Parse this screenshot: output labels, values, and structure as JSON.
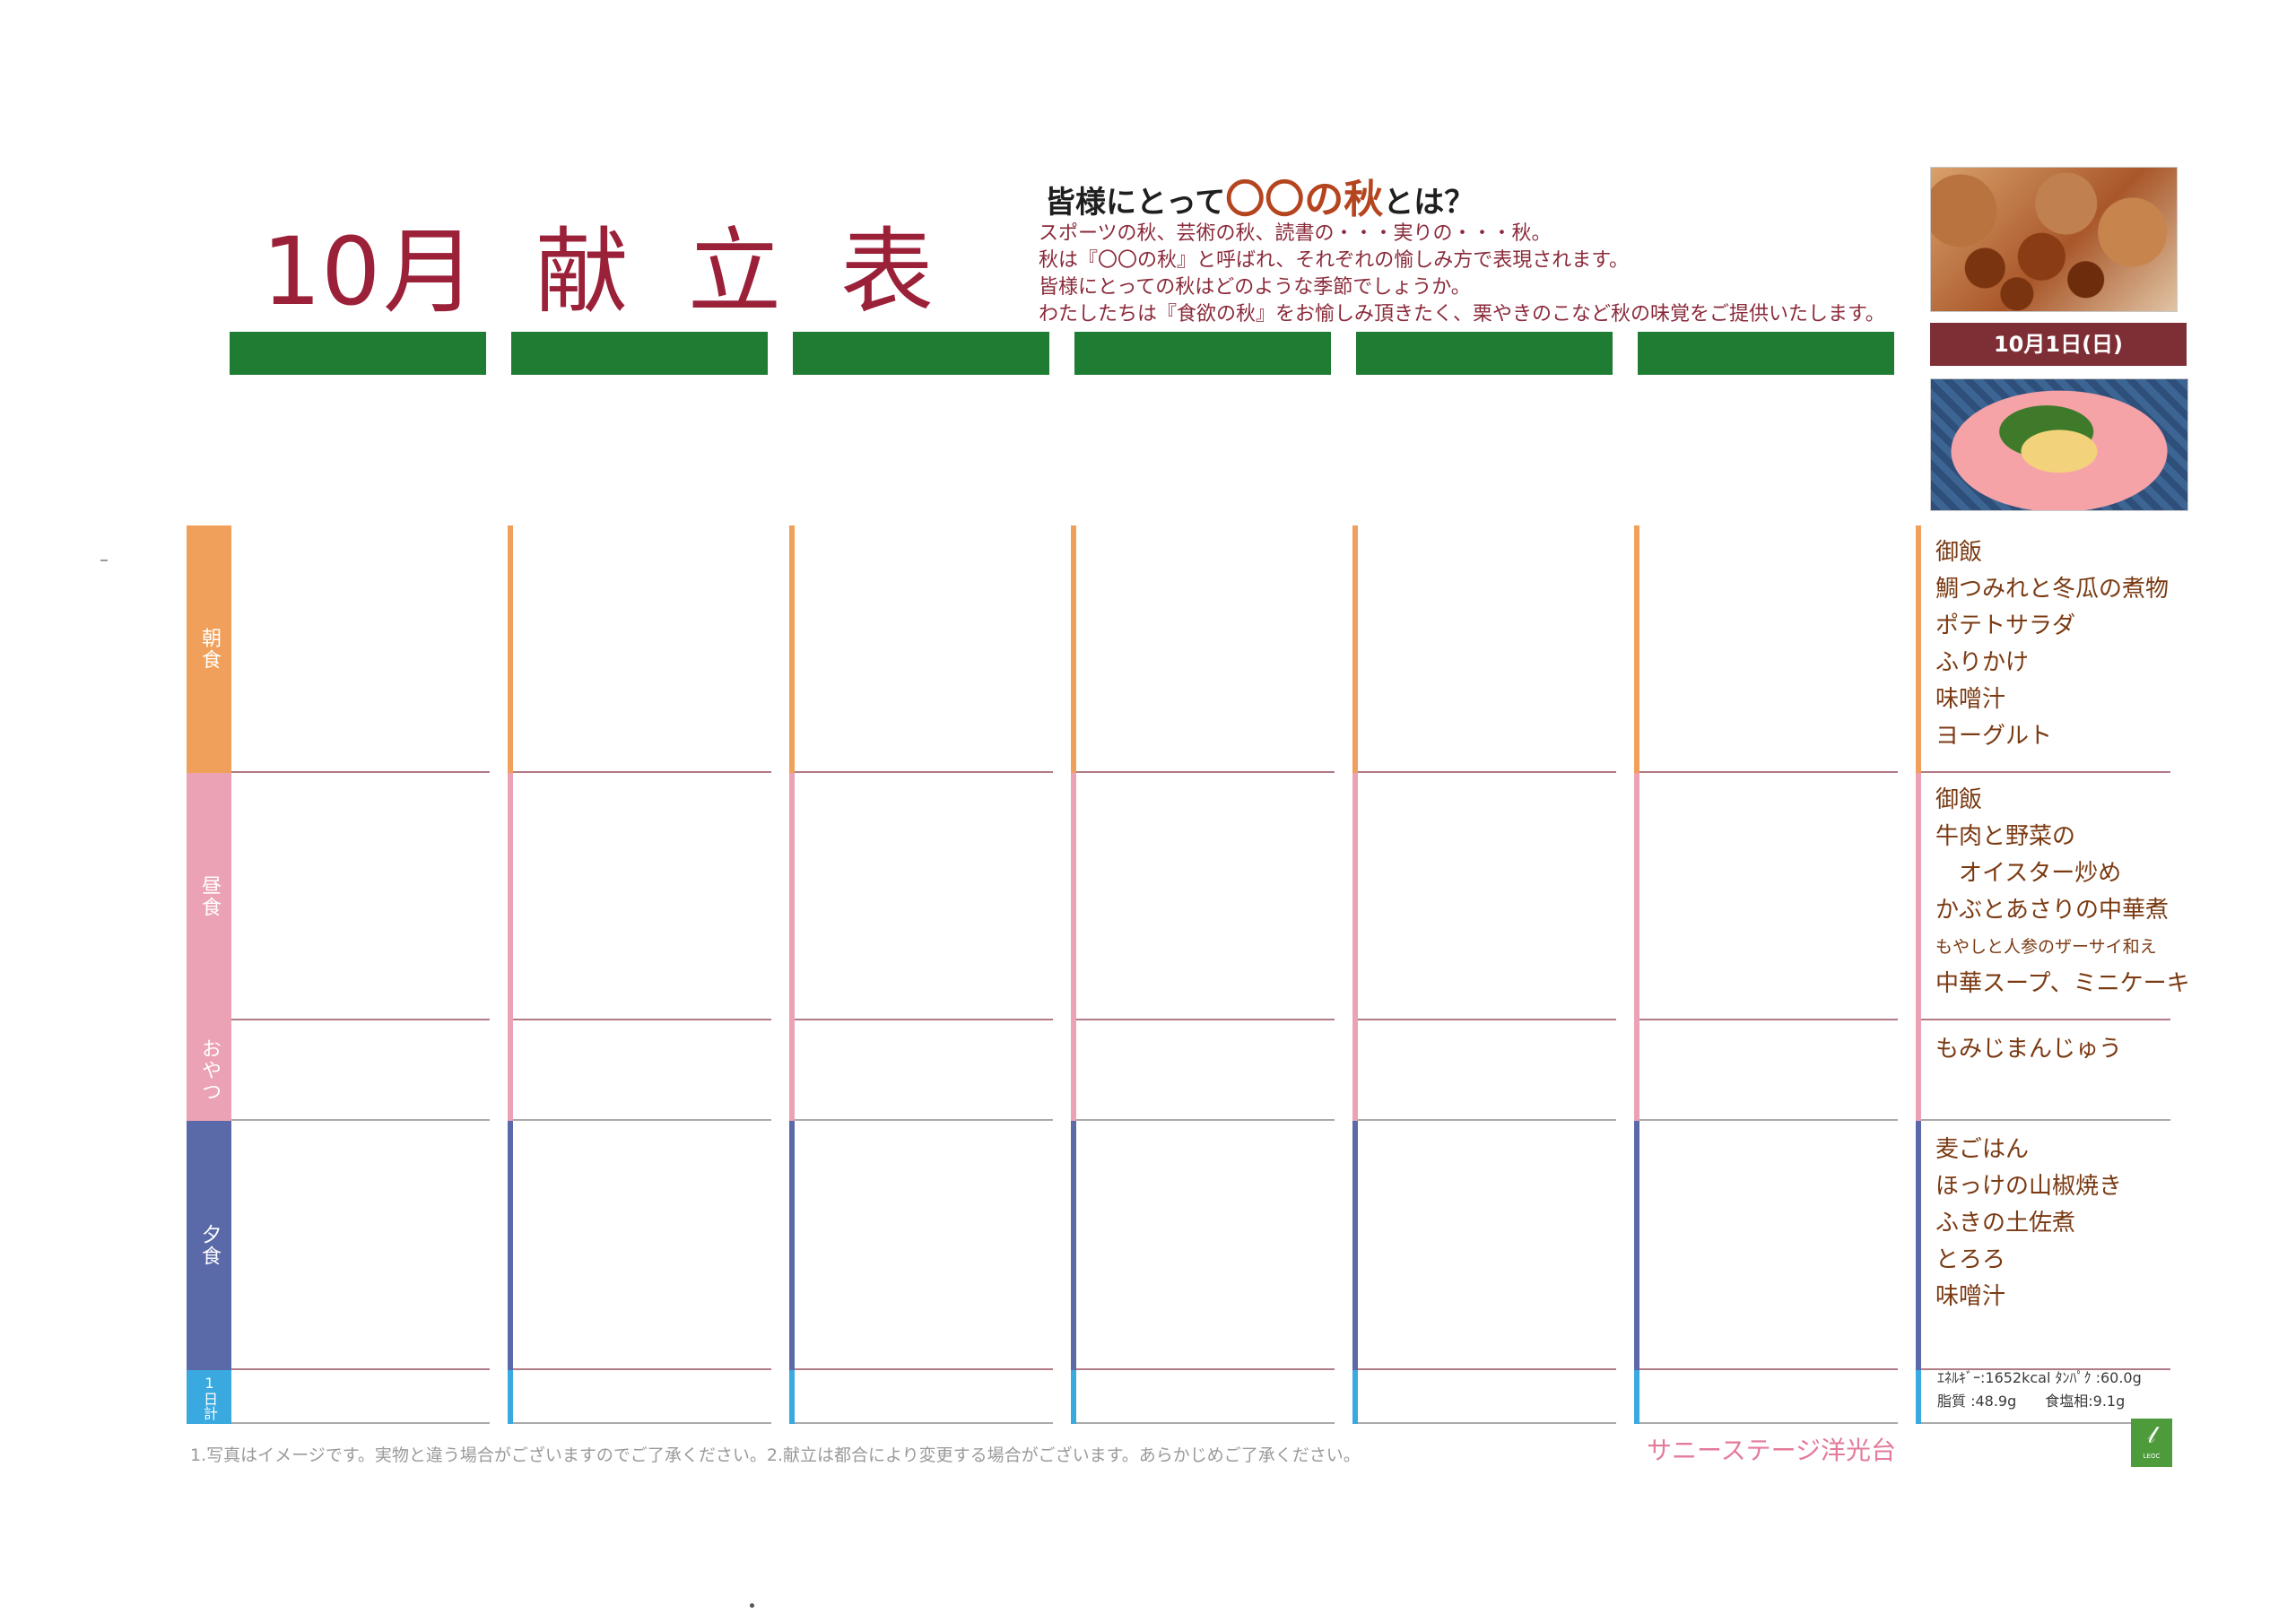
{
  "title": [
    "10",
    "月",
    "献",
    "立",
    "表"
  ],
  "intro": {
    "heading_pre": "皆様にとって",
    "heading_hl": "〇〇の秋",
    "heading_post": "とは？",
    "lines": [
      "スポーツの秋、芸術の秋、読書の・・・実りの・・・秋。",
      "秋は『〇〇の秋』と呼ばれ、それぞれの愉しみ方で表現されます。",
      "皆様にとっての秋はどのような季節でしょうか。",
      "わたしたちは『食欲の秋』をお愉しみ頂きたく、栗やきのこなど秋の味覚をご提供いたします。"
    ]
  },
  "date_label": "10月1日(日)",
  "meal_labels": {
    "breakfast": "朝食",
    "lunch": "昼食",
    "snack": "おやつ",
    "dinner": "夕食",
    "daily_total": "1日計"
  },
  "colors": {
    "breakfast": "#f0a05a",
    "lunch": "#eba2b5",
    "dinner": "#5a6aa8",
    "daily_total": "#3aa9e0",
    "header_green": "#1e7d32",
    "title": "#9b2139"
  },
  "menu": {
    "breakfast": [
      "御飯",
      "鯛つみれと冬瓜の煮物",
      "ポテトサラダ",
      "ふりかけ",
      "味噌汁",
      "ヨーグルト"
    ],
    "lunch": [
      "御飯",
      "牛肉と野菜の",
      "　オイスター炒め",
      "かぶとあさりの中華煮",
      "もやしと人参のザーサイ和え",
      "中華スープ、ミニケーキ"
    ],
    "snack": [
      "もみじまんじゅう"
    ],
    "dinner": [
      "麦ごはん",
      "ほっけの山椒焼き",
      "ふきの土佐煮",
      "とろろ",
      "味噌汁"
    ],
    "nutrition": [
      "ｴﾈﾙｷﾞｰ:1652kcal ﾀﾝﾊﾟｸ :60.0g",
      "脂質 :48.9g　　食塩相:9.1g"
    ]
  },
  "footnote": "1.写真はイメージです。実物と違う場合がございますのでご了承ください。2.献立は都合により変更する場合がございます。あらかじめご了承ください。",
  "organization": "サニーステージ洋光台",
  "logo_text": "LEOC"
}
